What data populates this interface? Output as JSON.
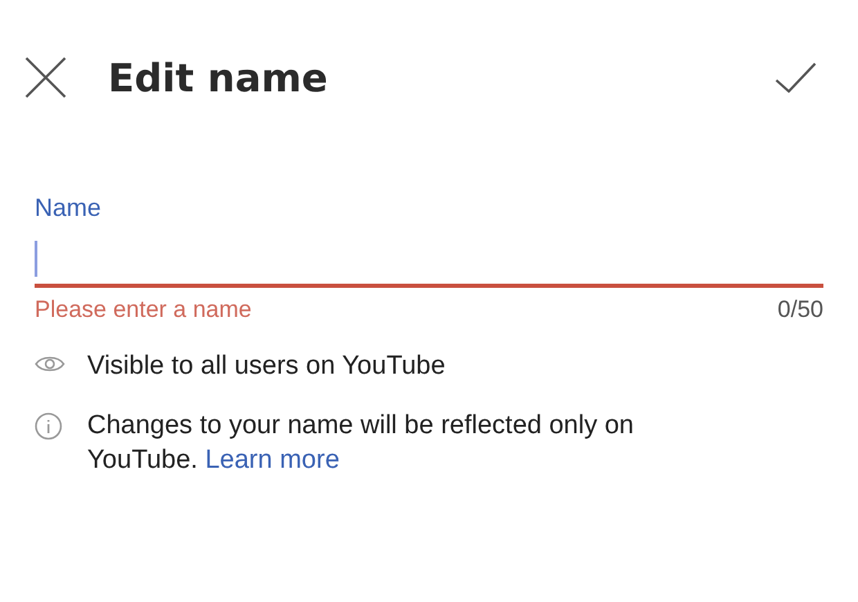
{
  "header": {
    "title": "Edit name"
  },
  "field": {
    "label": "Name",
    "error": true,
    "focused": true,
    "error_text": "Please enter a name",
    "counter": "0/50"
  },
  "notes": [
    {
      "kind": "eye",
      "text": "Visible to all users on YouTube"
    },
    {
      "kind": "info",
      "text": "Changes to your name will be reflected only on YouTube.",
      "link": "Learn more"
    }
  ]
}
